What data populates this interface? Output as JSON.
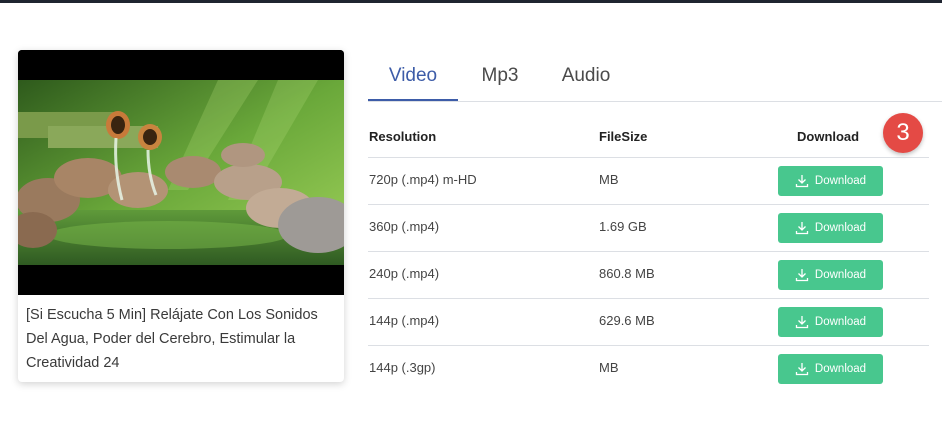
{
  "video": {
    "title": "[Si Escucha 5 Min] Relájate Con Los Sonidos Del Agua, Poder del Cerebro, Estimular la Creatividad 24"
  },
  "tabs": [
    {
      "label": "Video",
      "active": true
    },
    {
      "label": "Mp3",
      "active": false
    },
    {
      "label": "Audio",
      "active": false
    }
  ],
  "table": {
    "headers": {
      "resolution": "Resolution",
      "filesize": "FileSize",
      "download": "Download"
    },
    "rows": [
      {
        "resolution": "720p (.mp4) m-HD",
        "filesize": "MB",
        "button": "Download"
      },
      {
        "resolution": "360p (.mp4)",
        "filesize": "1.69 GB",
        "button": "Download"
      },
      {
        "resolution": "240p (.mp4)",
        "filesize": "860.8 MB",
        "button": "Download"
      },
      {
        "resolution": "144p (.mp4)",
        "filesize": "629.6 MB",
        "button": "Download"
      },
      {
        "resolution": "144p (.3gp)",
        "filesize": "MB",
        "button": "Download"
      }
    ]
  },
  "badge": {
    "number": "3"
  },
  "colors": {
    "accent": "#3d5ca8",
    "download_button": "#48c78e",
    "badge": "#e44a45"
  },
  "icons": {
    "download": "download-icon"
  }
}
